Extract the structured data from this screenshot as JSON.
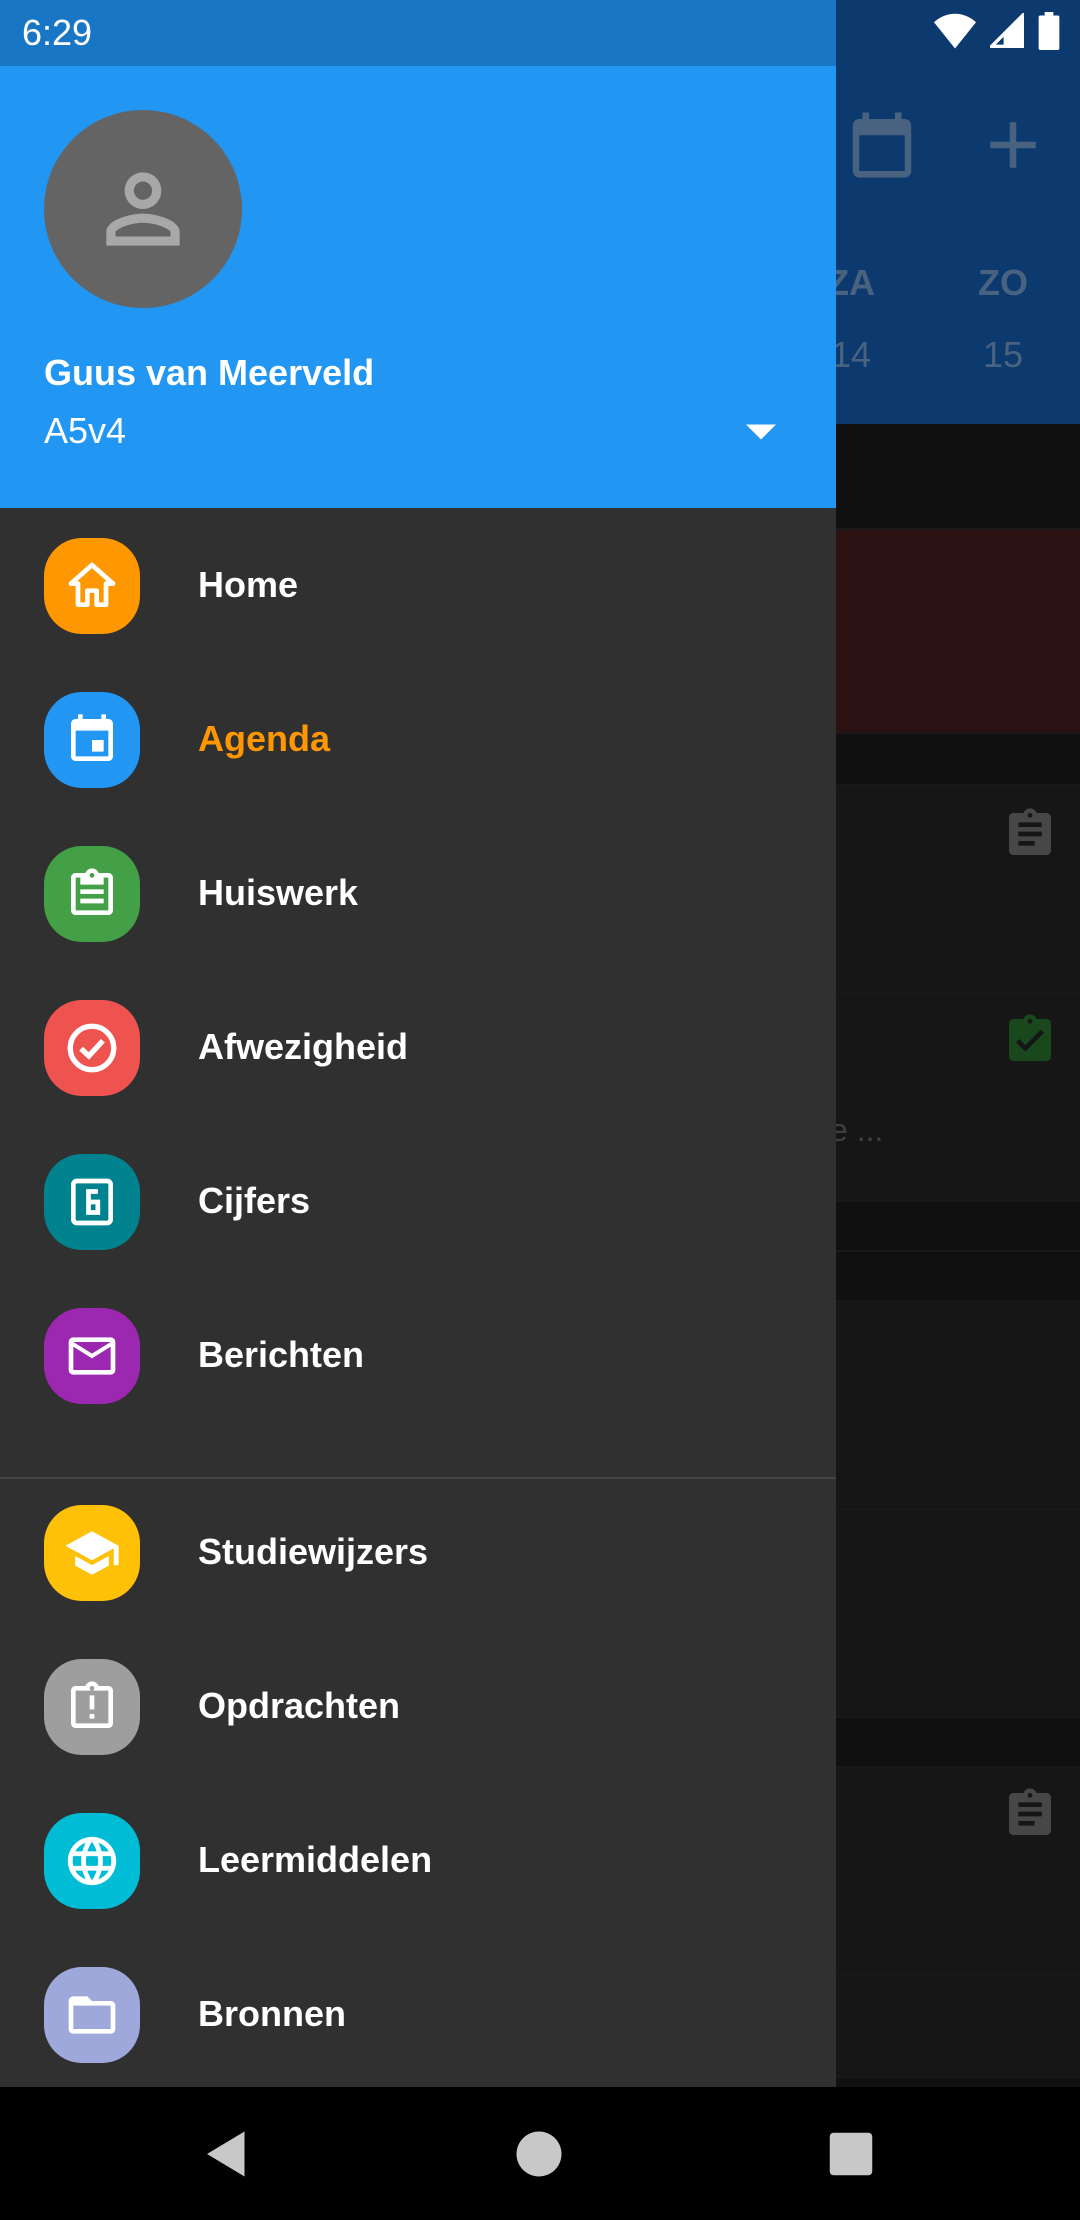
{
  "status_bar": {
    "time": "6:29"
  },
  "background": {
    "days": [
      {
        "name": "ZA",
        "number": "14"
      },
      {
        "name": "ZO",
        "number": "15"
      }
    ],
    "snippet": "e ..."
  },
  "drawer": {
    "user": {
      "name": "Guus van Meerveld",
      "class": "A5v4"
    },
    "primary_items": [
      {
        "label": "Home",
        "icon": "home-icon",
        "color": "#ff9800"
      },
      {
        "label": "Agenda",
        "icon": "calendar-icon",
        "color": "#2196f3",
        "active": true
      },
      {
        "label": "Huiswerk",
        "icon": "clipboard-icon",
        "color": "#43a047"
      },
      {
        "label": "Afwezigheid",
        "icon": "check-circle-icon",
        "color": "#ef5350"
      },
      {
        "label": "Cijfers",
        "icon": "grade-six-icon",
        "color": "#00838f"
      },
      {
        "label": "Berichten",
        "icon": "mail-icon",
        "color": "#9c27b0"
      }
    ],
    "secondary_items": [
      {
        "label": "Studiewijzers",
        "icon": "graduation-cap-icon",
        "color": "#ffc107"
      },
      {
        "label": "Opdrachten",
        "icon": "assignment-alert-icon",
        "color": "#9e9e9e"
      },
      {
        "label": "Leermiddelen",
        "icon": "globe-icon",
        "color": "#00bcd4"
      },
      {
        "label": "Bronnen",
        "icon": "folder-icon",
        "color": "#9fa8da"
      }
    ],
    "active_color": "#ff9800",
    "header_color": "#2196f3"
  }
}
